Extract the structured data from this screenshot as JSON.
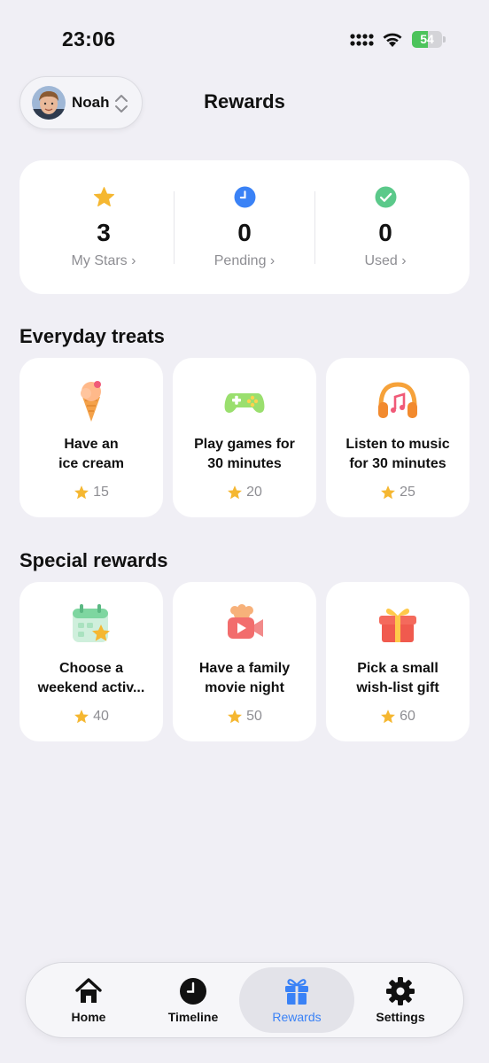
{
  "status_bar": {
    "time": "23:06",
    "battery_level": "54",
    "battery_fraction": 0.54
  },
  "header": {
    "profile_name": "Noah",
    "title": "Rewards"
  },
  "stats": [
    {
      "value": "3",
      "label": "My Stars ›",
      "icon": "star-icon"
    },
    {
      "value": "0",
      "label": "Pending ›",
      "icon": "clock-icon"
    },
    {
      "value": "0",
      "label": "Used ›",
      "icon": "check-circle-icon"
    }
  ],
  "everyday": {
    "title": "Everyday treats",
    "items": [
      {
        "line1": "Have an",
        "line2": "ice cream",
        "cost": "15",
        "icon": "ice-cream-icon"
      },
      {
        "line1": "Play games for",
        "line2": "30 minutes",
        "cost": "20",
        "icon": "gamepad-icon"
      },
      {
        "line1": "Listen to music",
        "line2": "for 30 minutes",
        "cost": "25",
        "icon": "headphones-icon"
      }
    ]
  },
  "special": {
    "title": "Special rewards",
    "items": [
      {
        "line1": "Choose a",
        "line2": "weekend activ...",
        "cost": "40",
        "icon": "calendar-star-icon"
      },
      {
        "line1": "Have a family",
        "line2": "movie night",
        "cost": "50",
        "icon": "movie-camera-icon"
      },
      {
        "line1": "Pick a small",
        "line2": "wish-list gift",
        "cost": "60",
        "icon": "gift-icon"
      }
    ]
  },
  "tabs": [
    {
      "label": "Home",
      "icon": "home-icon",
      "active": false
    },
    {
      "label": "Timeline",
      "icon": "clock-icon",
      "active": false
    },
    {
      "label": "Rewards",
      "icon": "gift-icon",
      "active": true
    },
    {
      "label": "Settings",
      "icon": "gear-icon",
      "active": false
    }
  ],
  "colors": {
    "accent": "#3A82F6",
    "star": "#F5B731",
    "check": "#5BC98A",
    "background": "#F0EFF5"
  }
}
